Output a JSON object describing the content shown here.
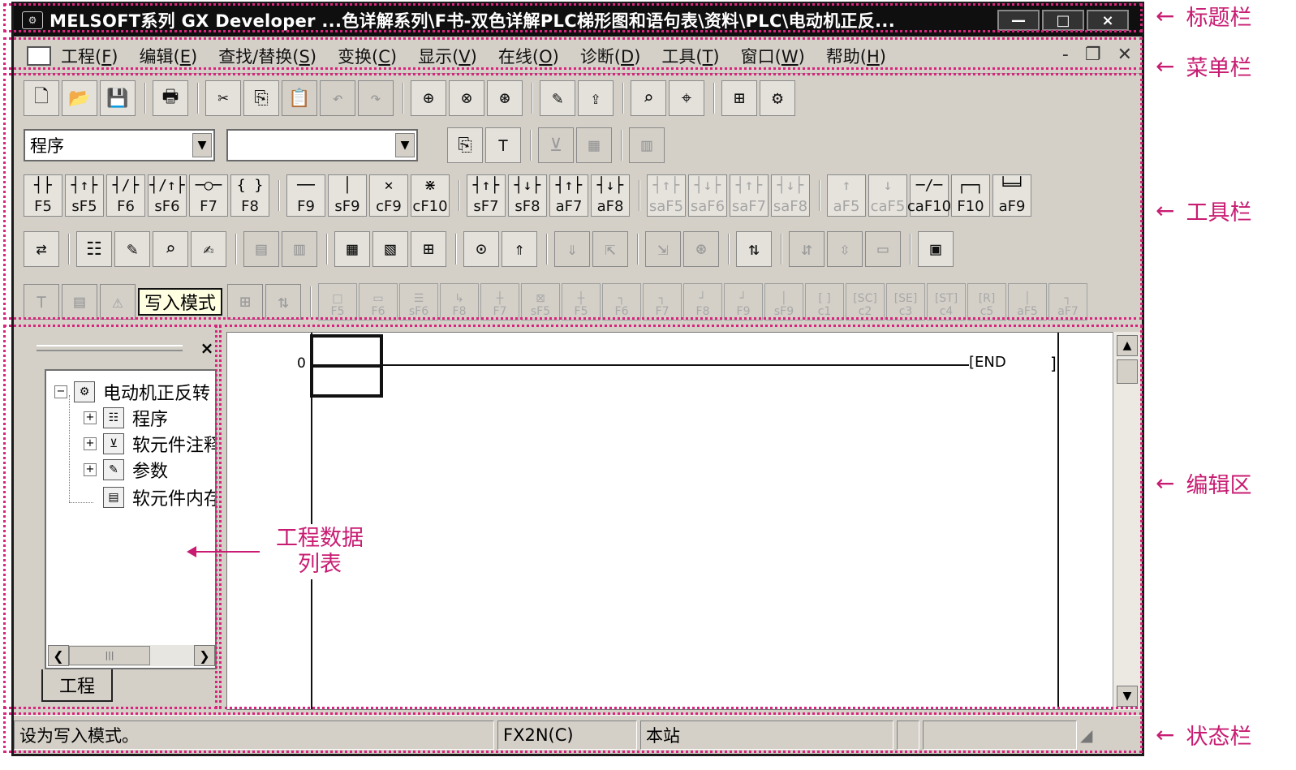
{
  "window": {
    "title": "MELSOFT系列 GX Developer ...色详解系列\\F书-双色详解PLC梯形图和语句表\\资料\\PLC\\电动机正反...",
    "controls": [
      "—",
      "□",
      "×"
    ]
  },
  "menu": {
    "items": [
      {
        "label": "工程(",
        "key": "F",
        "end": ")"
      },
      {
        "label": "编辑(",
        "key": "E",
        "end": ")"
      },
      {
        "label": "查找/替换(",
        "key": "S",
        "end": ")"
      },
      {
        "label": "变换(",
        "key": "C",
        "end": ")"
      },
      {
        "label": "显示(",
        "key": "V",
        "end": ")"
      },
      {
        "label": "在线(",
        "key": "O",
        "end": ")"
      },
      {
        "label": "诊断(",
        "key": "D",
        "end": ")"
      },
      {
        "label": "工具(",
        "key": "T",
        "end": ")"
      },
      {
        "label": "窗口(",
        "key": "W",
        "end": ")"
      },
      {
        "label": "帮助(",
        "key": "H",
        "end": ")"
      }
    ],
    "mdi_controls": [
      "-",
      "❐",
      "✕"
    ]
  },
  "toolbar": {
    "row1_icons": [
      "new-icon",
      "open-icon",
      "save-icon",
      "print-icon",
      "cut-icon",
      "copy-icon",
      "paste-icon",
      "undo-icon",
      "redo-icon",
      "find-device-icon",
      "find-instruction-icon",
      "find-step-icon",
      "write-plc-icon",
      "read-plc-icon",
      "monitor-start-icon",
      "monitor-stop-icon",
      "ladder-view-icon",
      "verify-icon"
    ],
    "row1_glyphs": [
      "🗋",
      "📂",
      "💾",
      "🖶",
      "✂",
      "⎘",
      "📋",
      "↶",
      "↷",
      "⊕",
      "⊗",
      "⊛",
      "✎",
      "⇪",
      "⌕",
      "⌖",
      "⊞",
      "⚙"
    ],
    "program_combo": "程序",
    "second_combo": "",
    "ladder_keys": [
      {
        "sym": "┤├",
        "key": "F5"
      },
      {
        "sym": "┤↑├",
        "key": "sF5"
      },
      {
        "sym": "┤/├",
        "key": "F6"
      },
      {
        "sym": "┤/↑├",
        "key": "sF6"
      },
      {
        "sym": "─○─",
        "key": "F7"
      },
      {
        "sym": "{ }",
        "key": "F8"
      },
      {
        "sym": "──",
        "key": "F9"
      },
      {
        "sym": "│",
        "key": "sF9"
      },
      {
        "sym": "✕",
        "key": "cF9"
      },
      {
        "sym": "⋇",
        "key": "cF10"
      },
      {
        "sym": "┤↑├",
        "key": "sF7"
      },
      {
        "sym": "┤↓├",
        "key": "sF8"
      },
      {
        "sym": "┤↑├",
        "key": "aF7"
      },
      {
        "sym": "┤↓├",
        "key": "aF8"
      },
      {
        "sym": "┤↑├",
        "key": "saF5",
        "disabled": true
      },
      {
        "sym": "┤↓├",
        "key": "saF6",
        "disabled": true
      },
      {
        "sym": "┤↑├",
        "key": "saF7",
        "disabled": true
      },
      {
        "sym": "┤↓├",
        "key": "saF8",
        "disabled": true
      },
      {
        "sym": "↑",
        "key": "aF5",
        "disabled": true
      },
      {
        "sym": "↓",
        "key": "caF5",
        "disabled": true
      },
      {
        "sym": "─/─",
        "key": "caF10"
      },
      {
        "sym": "┌─┐",
        "key": "F10"
      },
      {
        "sym": "╘═╛",
        "key": "aF9"
      }
    ],
    "row4_icons": [
      "ladder-convert-icon",
      "list-mode-icon",
      "write-mode-icon",
      "read-mode-icon",
      "monitor-mode-icon",
      "comment-icon",
      "statement-icon",
      "note-icon",
      "alias-icon",
      "insert-icon",
      "device-batch-icon",
      "timer-icon",
      "step-up-icon",
      "step-down-icon",
      "zoom-in-icon",
      "zoom-out-icon",
      "diagnostics-icon",
      "sfc-icon",
      "sfc2-icon",
      "sfc3-icon",
      "sample-icon"
    ],
    "row4_glyphs": [
      "⇄",
      "☷",
      "✎",
      "⌕",
      "✍",
      "▤",
      "▥",
      "▦",
      "▧",
      "⊞",
      "⊙",
      "⇑",
      "⇓",
      "⇱",
      "⇲",
      "⊛",
      "⇅",
      "⇵",
      "⇳",
      "▭",
      "▣"
    ],
    "tooltip": "写入模式",
    "sfc_keys": [
      {
        "sym": "□",
        "key": "F5"
      },
      {
        "sym": "▭",
        "key": "F6"
      },
      {
        "sym": "☰",
        "key": "sF6"
      },
      {
        "sym": "↳",
        "key": "F8"
      },
      {
        "sym": "┼",
        "key": "F7"
      },
      {
        "sym": "⊠",
        "key": "sF5"
      },
      {
        "sym": "┼",
        "key": "F5"
      },
      {
        "sym": "┐",
        "key": "F6"
      },
      {
        "sym": "┐",
        "key": "F7"
      },
      {
        "sym": "┘",
        "key": "F8"
      },
      {
        "sym": "┘",
        "key": "F9"
      },
      {
        "sym": "│",
        "key": "sF9"
      },
      {
        "sym": "[ ]",
        "key": "c1"
      },
      {
        "sym": "[SC]",
        "key": "c2"
      },
      {
        "sym": "[SE]",
        "key": "c3"
      },
      {
        "sym": "[ST]",
        "key": "c4"
      },
      {
        "sym": "[R]",
        "key": "c5"
      },
      {
        "sym": "│",
        "key": "aF5"
      },
      {
        "sym": "┐",
        "key": "aF7"
      }
    ]
  },
  "project_pane": {
    "root": "电动机正反转",
    "children": [
      "程序",
      "软元件注释",
      "参数",
      "软元件内存"
    ],
    "tab": "工程"
  },
  "editor": {
    "step": "0",
    "end_label": "[END",
    "end_bracket": "]"
  },
  "status": {
    "message": "设为写入模式。",
    "plc_type": "FX2N(C)",
    "station": "本站"
  },
  "annotations": {
    "title_bar": "标题栏",
    "menu_bar": "菜单栏",
    "toolbar": "工具栏",
    "edit_area": "编辑区",
    "status_bar": "状态栏",
    "project_list": [
      "工程数据",
      "列表"
    ]
  },
  "colors": {
    "annotation": "#c81c72",
    "window_face": "#d4d0c8",
    "titlebar": "#0f0f0f"
  }
}
